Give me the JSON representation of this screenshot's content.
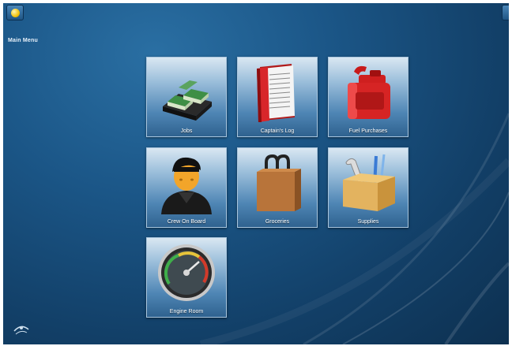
{
  "header": {
    "menu_title": "Main Menu"
  },
  "tiles": [
    {
      "label": "Jobs",
      "icon": "money-stacks-icon"
    },
    {
      "label": "Captain's Log",
      "icon": "log-book-icon"
    },
    {
      "label": "Fuel Purchases",
      "icon": "fuel-can-icon"
    },
    {
      "label": "Crew On Board",
      "icon": "crew-person-icon"
    },
    {
      "label": "Groceries",
      "icon": "shopping-bag-icon"
    },
    {
      "label": "Supplies",
      "icon": "supply-box-icon"
    },
    {
      "label": "Engine Room",
      "icon": "gauge-icon"
    }
  ],
  "colors": {
    "background": "#1b5687",
    "tile_top": "#d9e7f2",
    "tile_bottom": "#2f628f",
    "label": "#ffffff"
  }
}
